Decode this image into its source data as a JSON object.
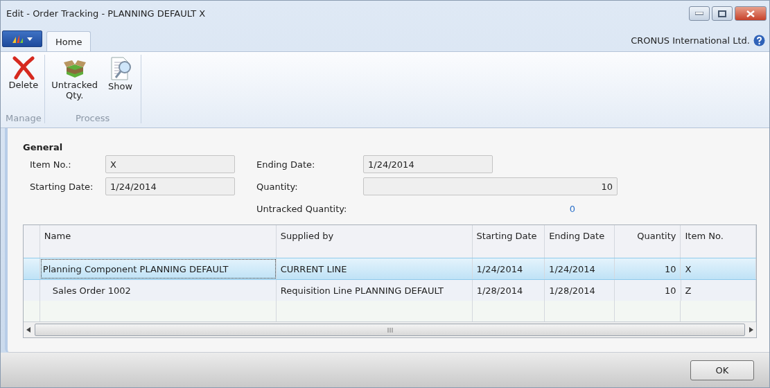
{
  "window": {
    "title": "Edit - Order Tracking - PLANNING DEFAULT X"
  },
  "tabs": [
    {
      "label": "Home",
      "selected": true
    }
  ],
  "company": "CRONUS International Ltd.",
  "ribbon_groups": [
    {
      "label": "Manage",
      "actions": [
        {
          "label": "Delete",
          "kind": "delete"
        }
      ]
    },
    {
      "label": "Process",
      "actions": [
        {
          "label": "Untracked Qty.",
          "kind": "box"
        },
        {
          "label": "Show",
          "kind": "show"
        }
      ]
    }
  ],
  "general": {
    "title": "General",
    "left_fields": [
      {
        "label": "Item No.:",
        "value": "X",
        "kind": "text"
      },
      {
        "label": "Starting Date:",
        "value": "1/24/2014",
        "kind": "text"
      }
    ],
    "right_fields": [
      {
        "label": "Ending Date:",
        "value": "1/24/2014",
        "kind": "text"
      },
      {
        "label": "Quantity:",
        "value": "10",
        "kind": "number"
      },
      {
        "label": "Untracked Quantity:",
        "value": "0",
        "kind": "link"
      }
    ]
  },
  "table": {
    "columns": [
      "Name",
      "Supplied by",
      "Starting Date",
      "Ending Date",
      "Quantity",
      "Item No."
    ],
    "rows": [
      {
        "cells": [
          "Planning Component PLANNING DEFAULT",
          "CURRENT LINE",
          "1/24/2014",
          "1/24/2014",
          "10",
          "X"
        ],
        "selected": true,
        "children": [
          {
            "cells": [
              "Sales Order 1002",
              "Requisition Line PLANNING DEFAULT",
              "1/28/2014",
              "1/28/2014",
              "10",
              "Z"
            ],
            "selected": false
          }
        ]
      }
    ]
  },
  "buttons": [
    "OK"
  ]
}
